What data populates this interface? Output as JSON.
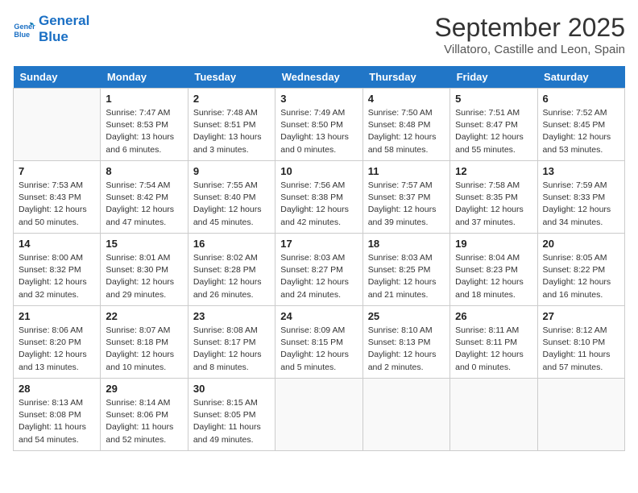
{
  "logo": {
    "line1": "General",
    "line2": "Blue"
  },
  "title": "September 2025",
  "subtitle": "Villatoro, Castille and Leon, Spain",
  "headers": [
    "Sunday",
    "Monday",
    "Tuesday",
    "Wednesday",
    "Thursday",
    "Friday",
    "Saturday"
  ],
  "weeks": [
    [
      null,
      {
        "date": "1",
        "sunrise": "7:47 AM",
        "sunset": "8:53 PM",
        "daylight": "13 hours and 6 minutes."
      },
      {
        "date": "2",
        "sunrise": "7:48 AM",
        "sunset": "8:51 PM",
        "daylight": "13 hours and 3 minutes."
      },
      {
        "date": "3",
        "sunrise": "7:49 AM",
        "sunset": "8:50 PM",
        "daylight": "13 hours and 0 minutes."
      },
      {
        "date": "4",
        "sunrise": "7:50 AM",
        "sunset": "8:48 PM",
        "daylight": "12 hours and 58 minutes."
      },
      {
        "date": "5",
        "sunrise": "7:51 AM",
        "sunset": "8:47 PM",
        "daylight": "12 hours and 55 minutes."
      },
      {
        "date": "6",
        "sunrise": "7:52 AM",
        "sunset": "8:45 PM",
        "daylight": "12 hours and 53 minutes."
      }
    ],
    [
      {
        "date": "7",
        "sunrise": "7:53 AM",
        "sunset": "8:43 PM",
        "daylight": "12 hours and 50 minutes."
      },
      {
        "date": "8",
        "sunrise": "7:54 AM",
        "sunset": "8:42 PM",
        "daylight": "12 hours and 47 minutes."
      },
      {
        "date": "9",
        "sunrise": "7:55 AM",
        "sunset": "8:40 PM",
        "daylight": "12 hours and 45 minutes."
      },
      {
        "date": "10",
        "sunrise": "7:56 AM",
        "sunset": "8:38 PM",
        "daylight": "12 hours and 42 minutes."
      },
      {
        "date": "11",
        "sunrise": "7:57 AM",
        "sunset": "8:37 PM",
        "daylight": "12 hours and 39 minutes."
      },
      {
        "date": "12",
        "sunrise": "7:58 AM",
        "sunset": "8:35 PM",
        "daylight": "12 hours and 37 minutes."
      },
      {
        "date": "13",
        "sunrise": "7:59 AM",
        "sunset": "8:33 PM",
        "daylight": "12 hours and 34 minutes."
      }
    ],
    [
      {
        "date": "14",
        "sunrise": "8:00 AM",
        "sunset": "8:32 PM",
        "daylight": "12 hours and 32 minutes."
      },
      {
        "date": "15",
        "sunrise": "8:01 AM",
        "sunset": "8:30 PM",
        "daylight": "12 hours and 29 minutes."
      },
      {
        "date": "16",
        "sunrise": "8:02 AM",
        "sunset": "8:28 PM",
        "daylight": "12 hours and 26 minutes."
      },
      {
        "date": "17",
        "sunrise": "8:03 AM",
        "sunset": "8:27 PM",
        "daylight": "12 hours and 24 minutes."
      },
      {
        "date": "18",
        "sunrise": "8:03 AM",
        "sunset": "8:25 PM",
        "daylight": "12 hours and 21 minutes."
      },
      {
        "date": "19",
        "sunrise": "8:04 AM",
        "sunset": "8:23 PM",
        "daylight": "12 hours and 18 minutes."
      },
      {
        "date": "20",
        "sunrise": "8:05 AM",
        "sunset": "8:22 PM",
        "daylight": "12 hours and 16 minutes."
      }
    ],
    [
      {
        "date": "21",
        "sunrise": "8:06 AM",
        "sunset": "8:20 PM",
        "daylight": "12 hours and 13 minutes."
      },
      {
        "date": "22",
        "sunrise": "8:07 AM",
        "sunset": "8:18 PM",
        "daylight": "12 hours and 10 minutes."
      },
      {
        "date": "23",
        "sunrise": "8:08 AM",
        "sunset": "8:17 PM",
        "daylight": "12 hours and 8 minutes."
      },
      {
        "date": "24",
        "sunrise": "8:09 AM",
        "sunset": "8:15 PM",
        "daylight": "12 hours and 5 minutes."
      },
      {
        "date": "25",
        "sunrise": "8:10 AM",
        "sunset": "8:13 PM",
        "daylight": "12 hours and 2 minutes."
      },
      {
        "date": "26",
        "sunrise": "8:11 AM",
        "sunset": "8:11 PM",
        "daylight": "12 hours and 0 minutes."
      },
      {
        "date": "27",
        "sunrise": "8:12 AM",
        "sunset": "8:10 PM",
        "daylight": "11 hours and 57 minutes."
      }
    ],
    [
      {
        "date": "28",
        "sunrise": "8:13 AM",
        "sunset": "8:08 PM",
        "daylight": "11 hours and 54 minutes."
      },
      {
        "date": "29",
        "sunrise": "8:14 AM",
        "sunset": "8:06 PM",
        "daylight": "11 hours and 52 minutes."
      },
      {
        "date": "30",
        "sunrise": "8:15 AM",
        "sunset": "8:05 PM",
        "daylight": "11 hours and 49 minutes."
      },
      null,
      null,
      null,
      null
    ]
  ]
}
